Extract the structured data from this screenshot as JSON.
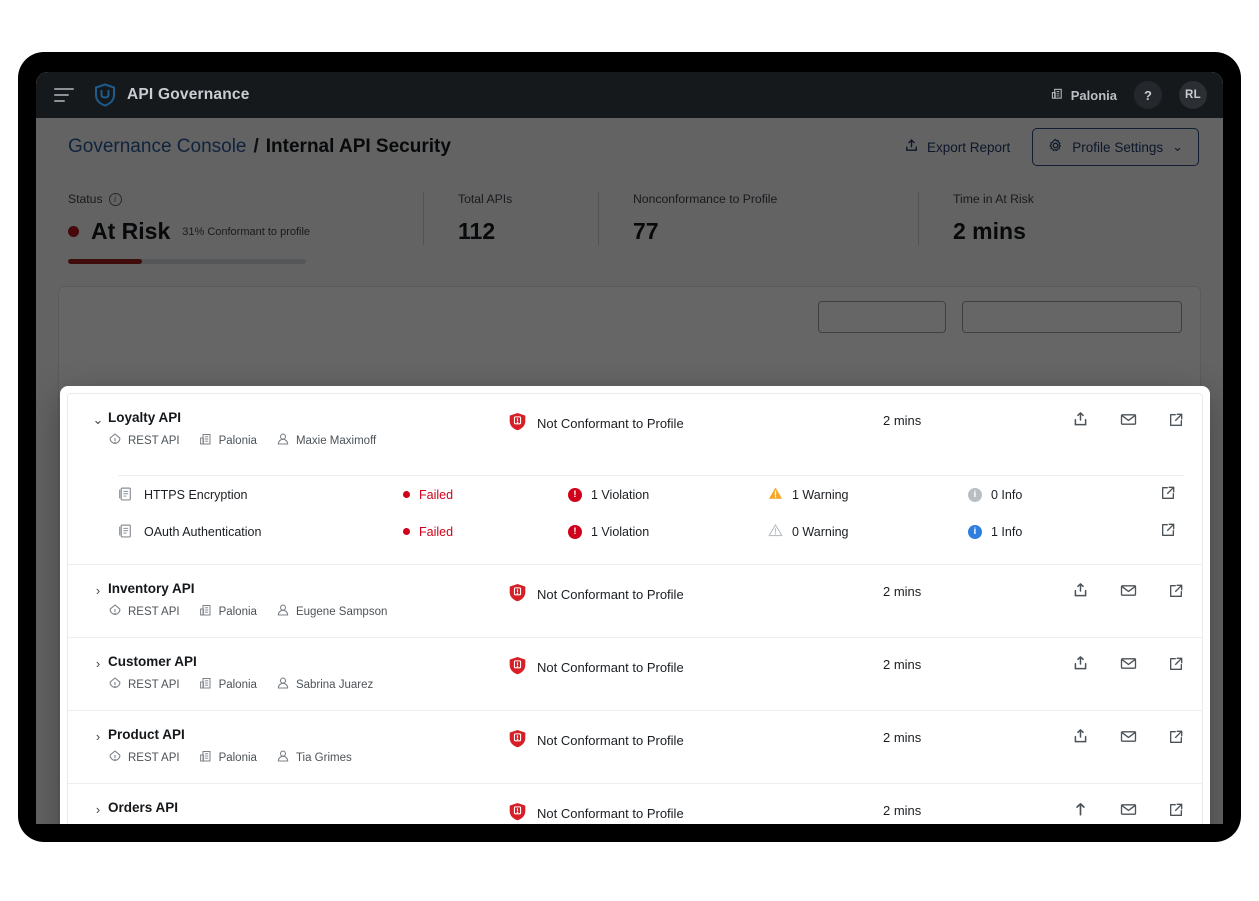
{
  "colors": {
    "accent_blue": "#2b5797",
    "danger_red": "#d0021b",
    "status_red": "#b0141b",
    "warning_yellow": "#f5a623",
    "info_blue": "#2f7fe0",
    "topbar_bg": "#16191c"
  },
  "topbar": {
    "menu_icon": "hamburger-icon",
    "logo_icon": "shield-logo-icon",
    "app_title": "API Governance",
    "org_icon": "organization-icon",
    "org_name": "Palonia",
    "help_label": "?",
    "avatar_initials": "RL"
  },
  "breadcrumb": {
    "parent": "Governance Console",
    "separator": "/",
    "current": "Internal API Security"
  },
  "page_actions": {
    "export_icon": "export-icon",
    "export_label": "Export Report",
    "settings_icon": "gear-icon",
    "settings_label": "Profile Settings",
    "settings_caret": "⌄"
  },
  "stats": {
    "status": {
      "label": "Status",
      "info_icon": "info-icon",
      "value": "At Risk",
      "sub": "31% Conformant to profile",
      "progress_percent": 31
    },
    "total_apis": {
      "label": "Total APIs",
      "value": "112"
    },
    "nonconformance": {
      "label": "Nonconformance to Profile",
      "value": "77"
    },
    "time_at_risk": {
      "label": "Time in At Risk",
      "value": "2 mins"
    }
  },
  "overlay": {
    "rows": [
      {
        "caret": "⌄",
        "expanded": true,
        "name": "Loyalty API",
        "meta": [
          {
            "icon": "api-type-icon",
            "text": "REST API"
          },
          {
            "icon": "organization-icon",
            "text": "Palonia"
          },
          {
            "icon": "user-icon",
            "text": "Maxie Maximoff"
          }
        ],
        "conformance_icon": "shield-alert-icon",
        "conformance": "Not Conformant to Profile",
        "time": "2 mins",
        "actions": [
          "share-icon",
          "mail-icon",
          "external-link-icon"
        ],
        "checks": [
          {
            "icon": "policy-doc-icon",
            "name": "HTTPS Encryption",
            "result": "Failed",
            "violations": "1 Violation",
            "violations_state": "on",
            "warnings": "1 Warning",
            "warnings_state": "on",
            "info": "0 Info",
            "info_state": "off",
            "link_icon": "external-link-icon"
          },
          {
            "icon": "policy-doc-icon",
            "name": "OAuth Authentication",
            "result": "Failed",
            "violations": "1 Violation",
            "violations_state": "on",
            "warnings": "0 Warning",
            "warnings_state": "off",
            "info": "1 Info",
            "info_state": "on",
            "link_icon": "external-link-icon"
          }
        ]
      },
      {
        "caret": "›",
        "expanded": false,
        "name": "Inventory API",
        "meta": [
          {
            "icon": "api-type-icon",
            "text": "REST API"
          },
          {
            "icon": "organization-icon",
            "text": "Palonia"
          },
          {
            "icon": "user-icon",
            "text": "Eugene Sampson"
          }
        ],
        "conformance_icon": "shield-alert-icon",
        "conformance": "Not Conformant to Profile",
        "time": "2 mins",
        "actions": [
          "share-icon",
          "mail-icon",
          "external-link-icon"
        ],
        "checks": []
      },
      {
        "caret": "›",
        "expanded": false,
        "name": "Customer API",
        "meta": [
          {
            "icon": "api-type-icon",
            "text": "REST API"
          },
          {
            "icon": "organization-icon",
            "text": "Palonia"
          },
          {
            "icon": "user-icon",
            "text": "Sabrina Juarez"
          }
        ],
        "conformance_icon": "shield-alert-icon",
        "conformance": "Not Conformant to Profile",
        "time": "2 mins",
        "actions": [
          "share-icon",
          "mail-icon",
          "external-link-icon"
        ],
        "checks": []
      },
      {
        "caret": "›",
        "expanded": false,
        "name": "Product API",
        "meta": [
          {
            "icon": "api-type-icon",
            "text": "REST API"
          },
          {
            "icon": "organization-icon",
            "text": "Palonia"
          },
          {
            "icon": "user-icon",
            "text": "Tia Grimes"
          }
        ],
        "conformance_icon": "shield-alert-icon",
        "conformance": "Not Conformant to Profile",
        "time": "2 mins",
        "actions": [
          "share-icon",
          "mail-icon",
          "external-link-icon"
        ],
        "checks": []
      },
      {
        "caret": "›",
        "expanded": false,
        "name": "Orders API",
        "meta": [],
        "conformance_icon": "shield-alert-icon",
        "conformance": "Not Conformant to Profile",
        "time": "2 mins",
        "actions": [
          "upload-arrow-icon",
          "mail-icon",
          "external-link-icon"
        ],
        "checks": []
      }
    ]
  },
  "background_list": {
    "partial_row": {
      "caret": "›",
      "name": "Orders API"
    }
  }
}
